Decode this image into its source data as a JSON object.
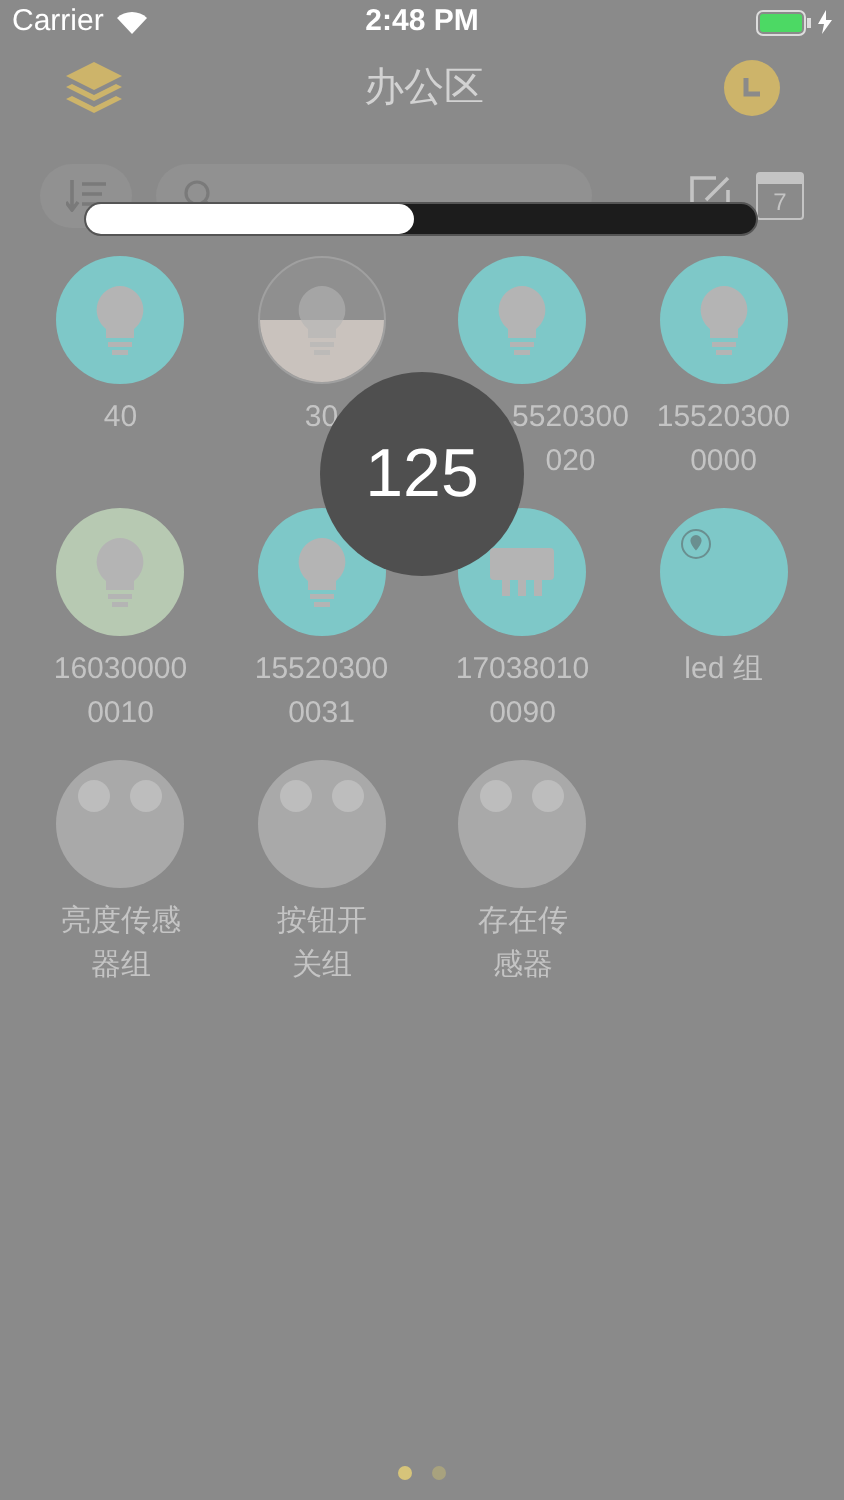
{
  "status_bar": {
    "carrier": "Carrier",
    "time": "2:48 PM"
  },
  "nav": {
    "title": "办公区"
  },
  "toolbar": {
    "calendar_day": "7"
  },
  "devices": [
    {
      "kind": "bulb",
      "label": "40",
      "color": "#7ec8c8"
    },
    {
      "kind": "half",
      "label": "30",
      "color": "#c9c2bd"
    },
    {
      "kind": "bulb",
      "label": "5520300\n020",
      "color": "#7ec8c8"
    },
    {
      "kind": "bulb",
      "label": "15520300\n0000",
      "color": "#7ec8c8"
    },
    {
      "kind": "bulb",
      "label": "16030000\n0010",
      "color": "#b7c9b2"
    },
    {
      "kind": "bulb",
      "label": "15520300\n0031",
      "color": "#7ec8c8"
    },
    {
      "kind": "curtain",
      "label": "17038010\n0090",
      "color": "#7ec8c8"
    },
    {
      "kind": "group",
      "label": "led 组",
      "color": "#7ec8c8"
    },
    {
      "kind": "sensor",
      "label": "亮度传感器组",
      "color": "#a9a9a9"
    },
    {
      "kind": "sensor",
      "label": "按钮开关组",
      "color": "#a9a9a9"
    },
    {
      "kind": "sensor",
      "label": "存在传感器",
      "color": "#a9a9a9"
    }
  ],
  "slider": {
    "level": 0.49
  },
  "bubble": {
    "value": "125"
  },
  "pages": [
    {
      "selected": true
    },
    {
      "selected": false
    }
  ]
}
